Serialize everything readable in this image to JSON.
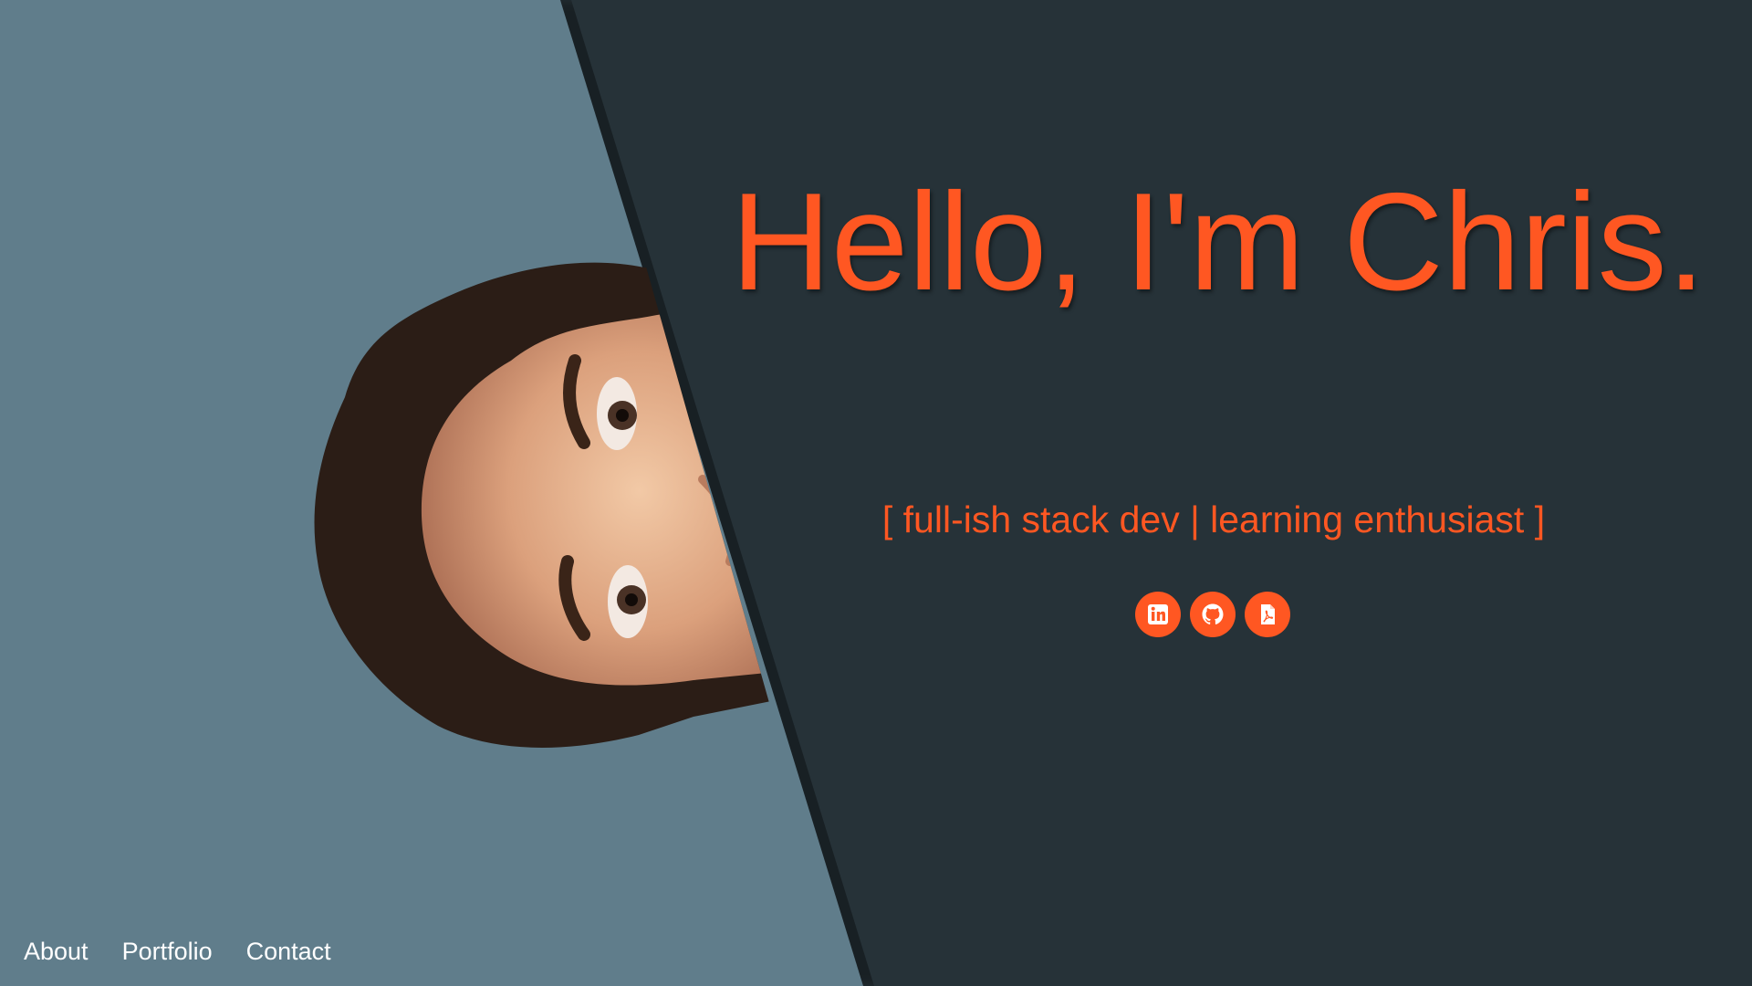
{
  "hero": {
    "title": "Hello, I'm Chris.",
    "subtitle": "[ full-ish stack dev | learning enthusiast ]"
  },
  "socials": [
    {
      "icon": "linkedin-icon"
    },
    {
      "icon": "github-icon"
    },
    {
      "icon": "pdf-resume-icon"
    }
  ],
  "nav": {
    "items": [
      {
        "label": "About"
      },
      {
        "label": "Portfolio"
      },
      {
        "label": "Contact"
      }
    ]
  },
  "colors": {
    "accent": "#ff5722",
    "dark_bg": "#263238",
    "slate_panel": "#607d8b",
    "nav_text": "#ffffff"
  }
}
